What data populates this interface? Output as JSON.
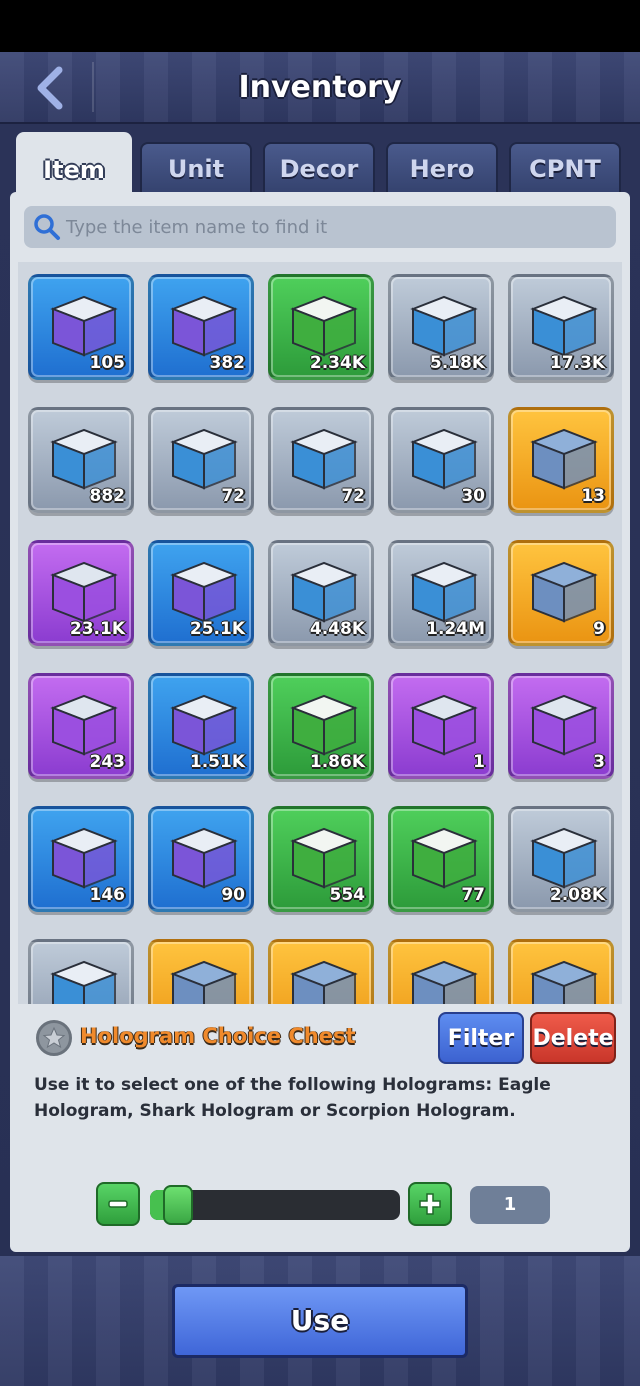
{
  "header": {
    "title": "Inventory",
    "back_icon": "back-arrow-icon"
  },
  "tabs": [
    {
      "label": "Item",
      "active": true
    },
    {
      "label": "Unit",
      "active": false
    },
    {
      "label": "Decor",
      "active": false
    },
    {
      "label": "Hero",
      "active": false
    },
    {
      "label": "CPNT",
      "active": false
    }
  ],
  "search": {
    "placeholder": "Type the item name to find it",
    "icon": "search-icon"
  },
  "items": [
    {
      "rarity": "blue",
      "icon": "purple-ammo-crate-icon",
      "qty": "105"
    },
    {
      "rarity": "blue",
      "icon": "mystery-crate-icon",
      "qty": "382"
    },
    {
      "rarity": "green",
      "icon": "green-supply-crate-icon",
      "qty": "2.34K"
    },
    {
      "rarity": "grey",
      "icon": "green-supply-crate-icon",
      "qty": "5.18K"
    },
    {
      "rarity": "grey",
      "icon": "green-crate-icon",
      "qty": "17.3K"
    },
    {
      "rarity": "grey",
      "icon": "green-crate-icon",
      "qty": "882"
    },
    {
      "rarity": "grey",
      "icon": "shield-crate-icon",
      "qty": "72"
    },
    {
      "rarity": "grey",
      "icon": "ammo-crate-icon",
      "qty": "72"
    },
    {
      "rarity": "grey",
      "icon": "mystery-crate-icon",
      "qty": "30"
    },
    {
      "rarity": "gold",
      "icon": "energy-cell-icon",
      "qty": "13"
    },
    {
      "rarity": "purple",
      "icon": "mech-part-crate-icon",
      "qty": "23.1K"
    },
    {
      "rarity": "blue",
      "icon": "science-crate-icon",
      "qty": "25.1K"
    },
    {
      "rarity": "grey",
      "icon": "tech-crate-icon",
      "qty": "4.48K"
    },
    {
      "rarity": "grey",
      "icon": "science-crate-icon",
      "qty": "1.24M"
    },
    {
      "rarity": "gold",
      "icon": "red-gear-crate-icon",
      "qty": "9"
    },
    {
      "rarity": "purple",
      "icon": "red-gear-crate-icon",
      "qty": "243"
    },
    {
      "rarity": "blue",
      "icon": "gold-gear-crate-icon",
      "qty": "1.51K"
    },
    {
      "rarity": "green",
      "icon": "teal-crate-icon",
      "qty": "1.86K"
    },
    {
      "rarity": "purple",
      "icon": "purple-mystery-chest-icon",
      "qty": "1"
    },
    {
      "rarity": "purple",
      "icon": "purple-chest-icon",
      "qty": "3"
    },
    {
      "rarity": "blue",
      "icon": "blue-mystery-chest-icon",
      "qty": "146"
    },
    {
      "rarity": "blue",
      "icon": "blue-chest-icon",
      "qty": "90"
    },
    {
      "rarity": "green",
      "icon": "green-mystery-chest-icon",
      "qty": "554"
    },
    {
      "rarity": "green",
      "icon": "green-chest-icon",
      "qty": "77"
    },
    {
      "rarity": "grey",
      "icon": "grey-mystery-chest-icon",
      "qty": "2.08K"
    },
    {
      "rarity": "grey",
      "icon": "grey-chest-icon",
      "qty": ""
    },
    {
      "rarity": "gold",
      "icon": "hologram-chest-icon",
      "qty": ""
    },
    {
      "rarity": "gold",
      "icon": "hologram-chest-icon",
      "qty": ""
    },
    {
      "rarity": "gold",
      "icon": "hologram-chest-icon",
      "qty": ""
    },
    {
      "rarity": "gold",
      "icon": "hologram-chest-icon",
      "qty": ""
    }
  ],
  "selected": {
    "name": "Hologram Choice Chest",
    "description": "Use it to select one of the following Holograms: Eagle Hologram, Shark Hologram or Scorpion Hologram.",
    "star_icon": "star-icon"
  },
  "actions": {
    "filter_label": "Filter",
    "delete_label": "Delete",
    "use_label": "Use"
  },
  "quantity": {
    "value": "1",
    "slider_fraction": 0.06,
    "minus_icon": "minus-icon",
    "plus_icon": "plus-icon"
  },
  "colors": {
    "blue": "#1f6fd0",
    "green": "#2d9b3a",
    "grey": "#8b99ad",
    "purple": "#8b3cd0",
    "gold": "#ea9412",
    "item_name": "#f08a2c",
    "panel": "#dfe4ea",
    "header": "#3f4a78"
  }
}
